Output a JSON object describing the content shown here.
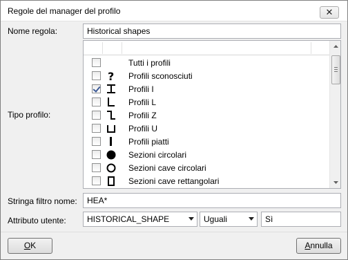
{
  "window": {
    "title": "Regole del manager del profilo",
    "close_glyph": "✕"
  },
  "rule_name": {
    "label": "Nome regola:",
    "value": "Historical shapes"
  },
  "profile_type": {
    "label": "Tipo profilo:",
    "items": [
      {
        "label": "Tutti i profili",
        "checked": false,
        "icon": "none"
      },
      {
        "label": "Profili sconosciuti",
        "checked": false,
        "icon": "question-mark-icon"
      },
      {
        "label": "Profili I",
        "checked": true,
        "icon": "i-beam-icon"
      },
      {
        "label": "Profili L",
        "checked": false,
        "icon": "l-angle-icon"
      },
      {
        "label": "Profili Z",
        "checked": false,
        "icon": "z-section-icon"
      },
      {
        "label": "Profili U",
        "checked": false,
        "icon": "u-channel-icon"
      },
      {
        "label": "Profili piatti",
        "checked": false,
        "icon": "flat-bar-icon"
      },
      {
        "label": "Sezioni circolari",
        "checked": false,
        "icon": "filled-circle-icon"
      },
      {
        "label": "Sezioni cave circolari",
        "checked": false,
        "icon": "hollow-circle-icon"
      },
      {
        "label": "Sezioni cave rettangolari",
        "checked": false,
        "icon": "hollow-rectangle-icon"
      }
    ]
  },
  "name_filter": {
    "label": "Stringa filtro nome:",
    "value": "HEA*"
  },
  "user_attribute": {
    "label": "Attributo utente:",
    "attribute": "HISTORICAL_SHAPE",
    "operator": "Uguali",
    "value": "Sì"
  },
  "buttons": {
    "ok": {
      "mnemonic": "O",
      "rest": "K"
    },
    "cancel": {
      "mnemonic": "A",
      "rest": "nnulla"
    }
  }
}
